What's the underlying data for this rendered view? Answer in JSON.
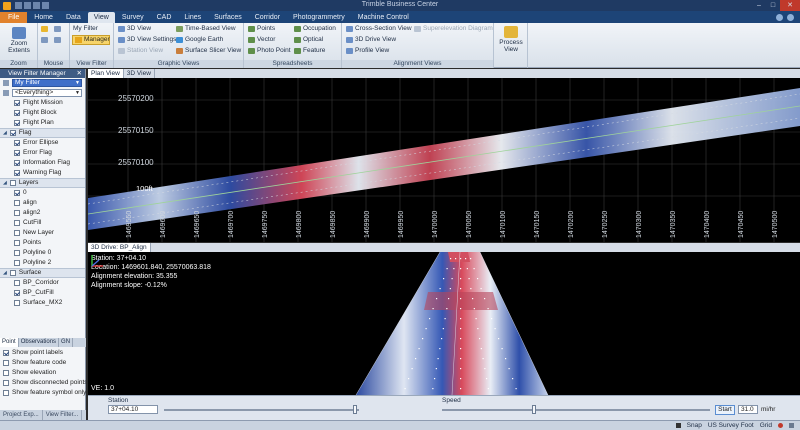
{
  "window": {
    "title": "Trimble Business Center"
  },
  "tabs": [
    "File",
    "Home",
    "Data",
    "View",
    "Survey",
    "CAD",
    "Lines",
    "Surfaces",
    "Corridor",
    "Photogrammetry",
    "Machine Control"
  ],
  "ribbon": {
    "zoom": {
      "zoom_extents": "Zoom Extents",
      "group": "Zoom"
    },
    "mouse": {
      "group": "Mouse"
    },
    "view_filter": {
      "my_filter": "My Filter",
      "manager": "Manager",
      "group": "View Filter"
    },
    "graphic_views": {
      "items": [
        "3D View",
        "3D View Settings",
        "Station View",
        "Time-Based View",
        "Google Earth",
        "Surface Slicer View"
      ],
      "group": "Graphic Views"
    },
    "spreadsheets": {
      "items": [
        "Points",
        "Vector",
        "Photo Point",
        "Occupation",
        "Optical",
        "Feature"
      ],
      "group": "Spreadsheets"
    },
    "alignment_views": {
      "items": [
        "Cross-Section View",
        "Superelevation Diagram",
        "3D Drive View",
        "Profile View"
      ],
      "group": "Alignment Views"
    },
    "process_view": "Process View"
  },
  "left_panel": {
    "header": "View Filter Manager",
    "filter_select": "My Filter",
    "everything_select": "<Everything>",
    "flight_items": [
      "Flight Mission",
      "Flight Block",
      "Flight Plan"
    ],
    "sections": {
      "flag": "Flag",
      "layers": "Layers",
      "surface": "Surface"
    },
    "flag_items": [
      "Error Ellipse",
      "Error Flag",
      "Information Flag",
      "Warning Flag"
    ],
    "layer_items": [
      "0",
      "align",
      "align2",
      "CutFill",
      "New Layer",
      "Points",
      "Polyline 0",
      "Polyline 2"
    ],
    "surface_items": [
      "BP_Corridor",
      "BP_CutFill",
      "Surface_MX2"
    ],
    "bottom_tabs": [
      "Point",
      "Observations",
      "GN"
    ],
    "options": [
      "Show point labels",
      "Show feature code",
      "Show elevation",
      "Show disconnected points",
      "Show feature symbol only"
    ],
    "footer_tabs": [
      "Project Exp...",
      "View Filter..."
    ]
  },
  "plan_view": {
    "tabs": [
      "Plan View",
      "3D View"
    ],
    "y_labels": [
      "25570200",
      "25570150",
      "25570100"
    ],
    "station_label": "100ft",
    "x_labels": [
      "1469550",
      "1469600",
      "1469650",
      "1469700",
      "1469750",
      "1469800",
      "1469850",
      "1469900",
      "1469950",
      "1470000",
      "1470050",
      "1470100",
      "1470150",
      "1470200",
      "1470250",
      "1470300",
      "1470350",
      "1470400",
      "1470450",
      "1470500"
    ]
  },
  "drive_view": {
    "tab": "3D Drive: BP_Align",
    "station": "Station: 37+04.10",
    "location": "Location: 1469601.840, 25570063.818",
    "elevation": "Alignment elevation: 35.355",
    "slope": "Alignment slope: -0.12%",
    "ve": "VE: 1.0"
  },
  "playback": {
    "station_label": "Station",
    "station_value": "37+04.10",
    "speed_label": "Speed",
    "start": "Start",
    "speed_value": "31.0",
    "speed_unit": "mi/hr"
  },
  "status_bar": {
    "snap": "Snap",
    "units": "US Survey Foot",
    "grid": "Grid"
  }
}
